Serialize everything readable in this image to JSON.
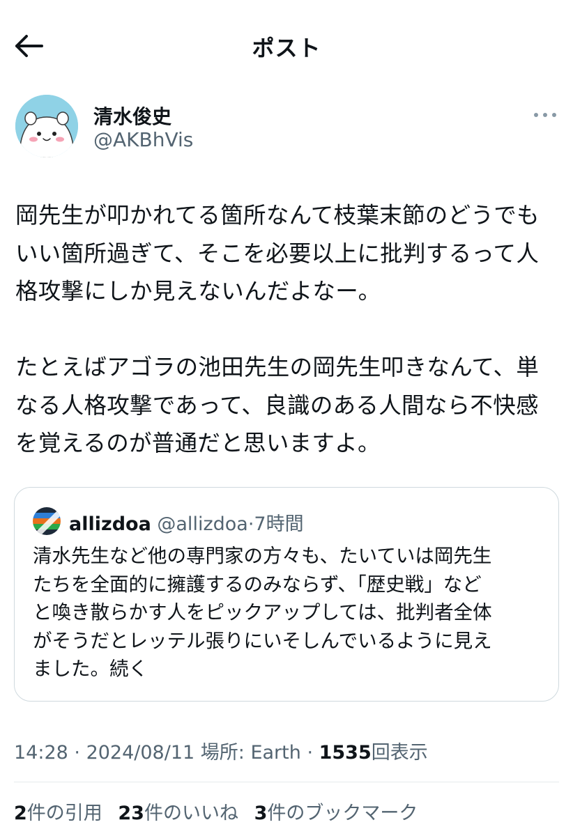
{
  "header": {
    "title": "ポスト",
    "back_icon": "arrow-left-icon"
  },
  "author": {
    "display_name": "清水俊史",
    "handle": "@AKBhVis",
    "avatar_icon": "chiikawa-avatar-icon",
    "more_icon": "more-horizontal-icon"
  },
  "post": {
    "text": "岡先生が叩かれてる箇所なんて枝葉末節のどうでも\nいい箇所過ぎて、そこを必要以上に批判するって人\n格攻撃にしか見えないんだよなー。\n\nたとえばアゴラの池田先生の岡先生叩きなんて、単\nなる人格攻撃であって、良識のある人間なら不快感\nを覚えるのが普通だと思いますよ。"
  },
  "quote": {
    "name": "allizdoa",
    "handle": "@allizdoa",
    "separator": "·",
    "time": "7時間",
    "text": "清水先生など他の専門家の方々も、たいていは岡先生\nたちを全面的に擁護するのみならず、「歴史戦」など\nと喚き散らかす人をピックアップしては、批判者全体\nがそうだとレッテル張りにいそしんでいるように見え\nました。続く",
    "avatar_icon": "striped-avatar-icon"
  },
  "meta": {
    "time": "14:28",
    "sep1": " · ",
    "date": "2024/08/11",
    "location": " 場所: Earth",
    "sep2": " · ",
    "views": "1535",
    "views_label": "回表示"
  },
  "stats": {
    "quotes_count": "2",
    "quotes_label": "件の引用",
    "likes_count": "23",
    "likes_label": "件のいいね",
    "bookmarks_count": "3",
    "bookmarks_label": "件のブックマーク"
  },
  "colors": {
    "text_primary": "#0f1419",
    "text_secondary": "#536471",
    "border": "#cfd9de",
    "avatar_bg": "#8fd2e6"
  }
}
